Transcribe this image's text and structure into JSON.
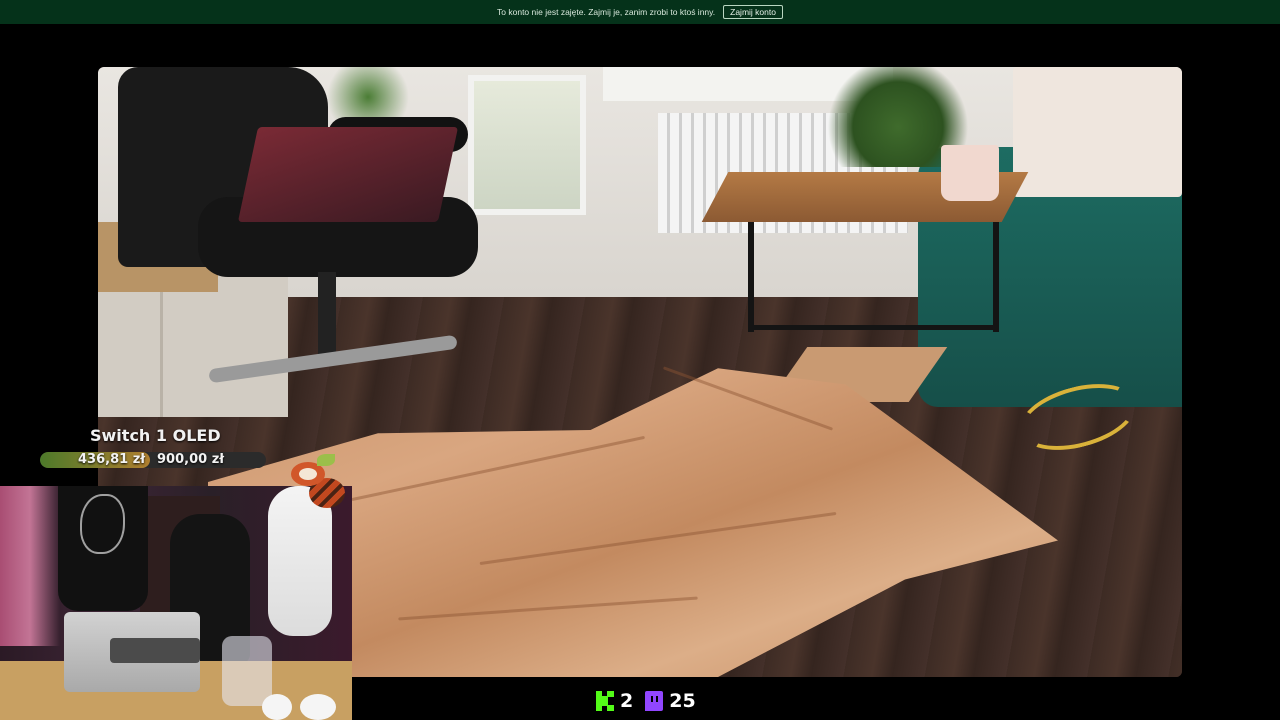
{
  "banner": {
    "message": "To konto nie jest zajęte. Zajmij je, zanim zrobi to ktoś inny.",
    "claim_button": "Zajmij konto",
    "bg_color": "#05321a"
  },
  "goal": {
    "title": "Switch 1 OLED",
    "current": "436,81 zł",
    "target": "900,00 zł",
    "progress_fraction": 0.485
  },
  "viewers": {
    "kick_icon": "kick-logo-icon",
    "kick_count": "2",
    "twitch_icon": "twitch-logo-icon",
    "twitch_count": "25",
    "kick_color": "#53fc18",
    "twitch_color": "#9146ff"
  },
  "mascot_icon": "red-panda-icon"
}
